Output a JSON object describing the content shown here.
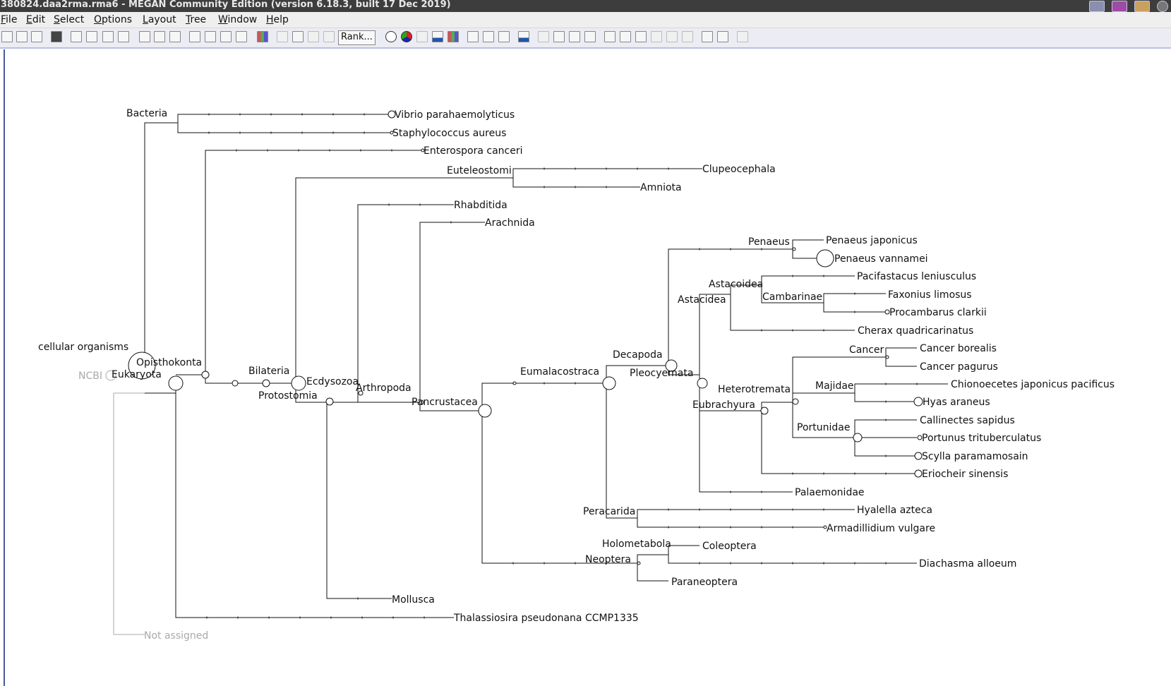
{
  "window": {
    "title": "380824.daa2rma.rma6 - MEGAN Community Edition (version 6.18.3, built 17 Dec 2019)"
  },
  "menu": [
    "File",
    "Edit",
    "Select",
    "Options",
    "Layout",
    "Tree",
    "Window",
    "Help"
  ],
  "toolbar": {
    "rank_button": "Rank..."
  },
  "tree": {
    "root": "NCBI",
    "nodes": {
      "cellular_organisms": "cellular organisms",
      "bacteria": "Bacteria",
      "eukaryota": "Eukaryota",
      "opisthokonta": "Opisthokonta",
      "bilateria": "Bilateria",
      "protostomia": "Protostomia",
      "ecdysozoa": "Ecdysozoa",
      "arthropoda": "Arthropoda",
      "pancrustacea": "Pancrustacea",
      "eumalacostraca": "Eumalacostraca",
      "decapoda": "Decapoda",
      "pleocyemata": "Pleocyemata",
      "penaeus": "Penaeus",
      "astacoidea": "Astacoidea",
      "astacidea": "Astacidea",
      "cambarinae": "Cambarinae",
      "heterotremata": "Heterotremata",
      "eubrachyura": "Eubrachyura",
      "cancer": "Cancer",
      "majidae": "Majidae",
      "portunidae": "Portunidae",
      "peracarida": "Peracarida",
      "holometabola": "Holometabola",
      "neoptera": "Neoptera",
      "euteleostomi": "Euteleostomi"
    },
    "leaves": {
      "vibrio": "Vibrio parahaemolyticus",
      "staphylococcus": "Staphylococcus aureus",
      "enterospora": "Enterospora canceri",
      "clupeocephala": "Clupeocephala",
      "amniota": "Amniota",
      "rhabditida": "Rhabditida",
      "arachnida": "Arachnida",
      "penaeus_japonicus": "Penaeus japonicus",
      "penaeus_vannamei": "Penaeus vannamei",
      "pacifastacus": "Pacifastacus leniusculus",
      "faxonius": "Faxonius limosus",
      "procambarus": "Procambarus clarkii",
      "cherax": "Cherax quadricarinatus",
      "cancer_borealis": "Cancer borealis",
      "cancer_pagurus": "Cancer pagurus",
      "chionoecetes": "Chionoecetes japonicus pacificus",
      "hyas": "Hyas araneus",
      "callinectes": "Callinectes sapidus",
      "portunus": "Portunus trituberculatus",
      "scylla": "Scylla paramamosain",
      "eriocheir": "Eriocheir sinensis",
      "palaemonidae": "Palaemonidae",
      "hyalella": "Hyalella azteca",
      "armadillidium": "Armadillidium vulgare",
      "coleoptera": "Coleoptera",
      "diachasma": "Diachasma alloeum",
      "paraneoptera": "Paraneoptera",
      "mollusca": "Mollusca",
      "thalassiosira": "Thalassiosira pseudonana CCMP1335",
      "not_assigned": "Not assigned"
    }
  }
}
